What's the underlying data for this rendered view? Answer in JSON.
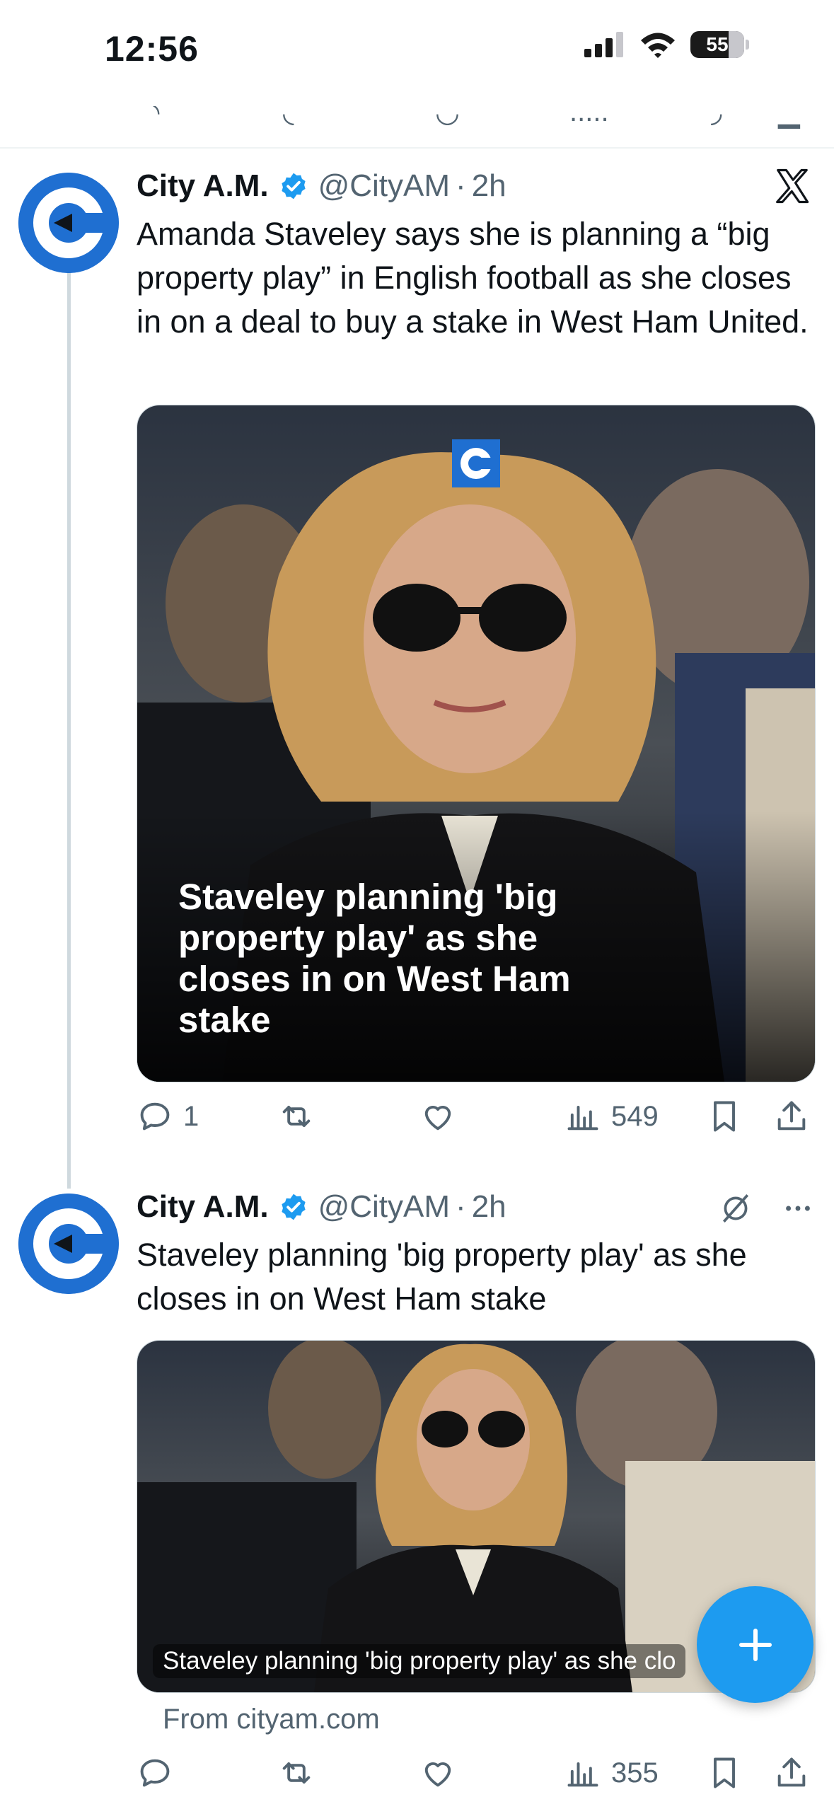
{
  "status_bar": {
    "time": "12:56",
    "battery": "55"
  },
  "posts": [
    {
      "name": "City A.M.",
      "handle": "@CityAM",
      "separator": "·",
      "age": "2h",
      "text": "Amanda Staveley says she is planning a “big property play” in English football as she closes in on a deal to buy a stake in West Ham United.",
      "media_headline": "Staveley planning 'big property play' as she closes in on West Ham stake",
      "actions": {
        "replies": "1",
        "reposts": "",
        "likes": "",
        "views": "549"
      }
    },
    {
      "name": "City A.M.",
      "handle": "@CityAM",
      "separator": "·",
      "age": "2h",
      "text": "Staveley planning 'big property play' as she closes in on West Ham stake",
      "media_caption": "Staveley planning 'big property play' as she clo",
      "source": "From cityam.com",
      "actions": {
        "replies": "",
        "reposts": "",
        "likes": "",
        "views": "355"
      }
    }
  ],
  "colors": {
    "accent": "#1d9bf0",
    "brand_blue": "#1f6fd1",
    "secondary_text": "#536471"
  },
  "icons": [
    "reply-icon",
    "repost-icon",
    "like-icon",
    "views-icon",
    "bookmark-icon",
    "share-icon",
    "x-logo-icon",
    "verified-badge-icon",
    "promoted-icon",
    "more-icon",
    "compose-icon"
  ]
}
